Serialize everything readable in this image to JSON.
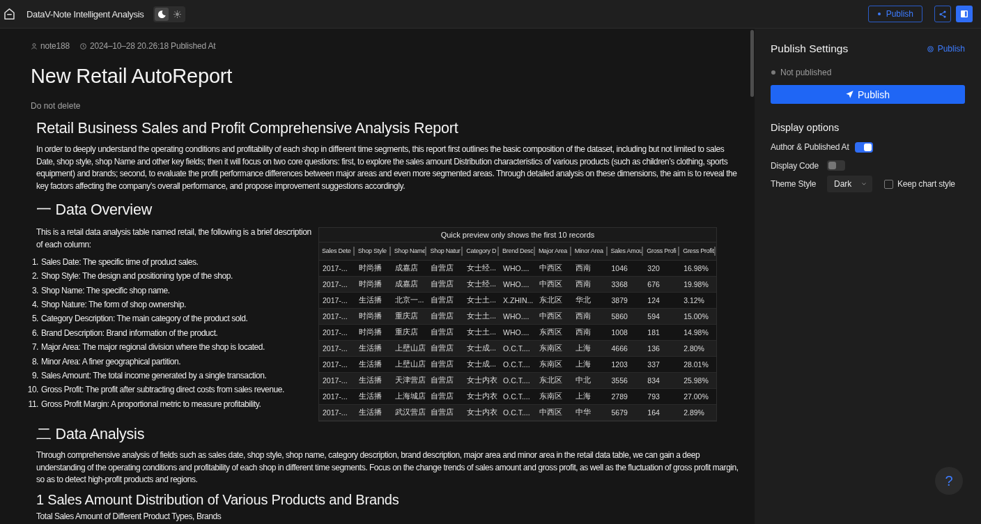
{
  "top_bar": {
    "title": "DataV-Note Intelligent Analysis",
    "theme_toggle": [
      {
        "kind": "dark",
        "selected": true
      },
      {
        "kind": "light",
        "selected": false
      }
    ],
    "publish_button": "Publish"
  },
  "report": {
    "author": "note188",
    "published_at": "2024–10–28 20.26:18 Published At",
    "title": "New Retail AutoReport",
    "note": "Do not delete",
    "blocks": [
      {
        "kind": "heading",
        "text": "Retail Business Sales and Profit Comprehensive Analysis Report"
      },
      {
        "kind": "paragraph",
        "text": "In order to deeply understand the operating conditions and profitability of each shop in different time segments, this report first outlines the basic composition of the dataset, including but not limited to sales Date, shop style, shop Name and other key fields; then it will focus on two core questions: first, to explore the sales amount Distribution characteristics of various products (such as children’s clothing, sports equipment) and brands; second, to evaluate the profit performance differences between major areas and even more segmented areas. Through detailed analysis on these dimensions, the aim is to reveal the key factors affecting the company’s overall performance, and propose improvement suggestions accordingly."
      },
      {
        "kind": "heading",
        "text": "一 Data Overview"
      },
      {
        "kind": "overview",
        "description": "This is a retail data analysis table named retail, the following is a brief description of each column:",
        "columns_description": [
          {
            "number": "1.",
            "text": "Sales Date: The specific time of product sales."
          },
          {
            "number": "2.",
            "text": "Shop Style: The design and positioning type of the shop."
          },
          {
            "number": "3.",
            "text": "Shop Name: The specific shop name."
          },
          {
            "number": "4.",
            "text": "Shop Nature: The form of shop ownership."
          },
          {
            "number": "5.",
            "text": "Category Description: The main category of the product sold."
          },
          {
            "number": "6.",
            "text": "Brand Description: Brand information of the product."
          },
          {
            "number": "7.",
            "text": "Major Area: The major regional division where the shop is located."
          },
          {
            "number": "8.",
            "text": "Minor Area: A finer geographical partition."
          },
          {
            "number": "9.",
            "text": "Sales Amount: The total income generated by a single transaction."
          },
          {
            "number": "10.",
            "text": "Gross Profit: The profit after subtracting direct costs from sales revenue."
          },
          {
            "number": "11.",
            "text": "Gross Profit Margin: A proportional metric to measure profitability."
          }
        ],
        "table": {
          "caption": "Quick preview only shows the first 10 records",
          "columns": [
            "Sales Dete",
            "Shop Style",
            "Shop Name",
            "Shop Natur",
            "Category D",
            "Brend Desc",
            "Major Area",
            "Minor Area",
            "Sales Amou",
            "Gross Profi",
            "Gress Profit"
          ],
          "rows": [
            [
              "2017-...",
              "时尚播",
              "成嘉店",
              "自营店",
              "女士经...",
              "WHO....",
              "中西区",
              "西南",
              "1046",
              "320",
              "16.98%"
            ],
            [
              "2017-...",
              "时尚播",
              "成嘉店",
              "自营店",
              "女士经...",
              "WHO....",
              "中西区",
              "西南",
              "3368",
              "676",
              "19.98%"
            ],
            [
              "2017-...",
              "生活播",
              "北京一...",
              "自营店",
              "女士土...",
              "X.ZHIN...",
              "东北区",
              "华北",
              "3879",
              "124",
              "3.12%"
            ],
            [
              "2017-...",
              "时尚播",
              "重庆店",
              "自营店",
              "女士土...",
              "WHO....",
              "中西区",
              "西南",
              "5860",
              "594",
              "15.00%"
            ],
            [
              "2017-...",
              "时尚播",
              "重庆店",
              "自营店",
              "女士土...",
              "WHO....",
              "东西区",
              "西南",
              "1008",
              "181",
              "14.98%"
            ],
            [
              "2017-...",
              "生活播",
              "上壁山店",
              "自营店",
              "女士成...",
              "O.C.T....",
              "东南区",
              "上海",
              "4666",
              "136",
              "2.80%"
            ],
            [
              "2017-...",
              "生活播",
              "上壁山店",
              "自营店",
              "女士成...",
              "O.C.T....",
              "东南区",
              "上海",
              "1203",
              "337",
              "28.01%"
            ],
            [
              "2017-...",
              "生活播",
              "天津营店",
              "自营店",
              "女士内衣",
              "O.C.T....",
              "东北区",
              "中北",
              "3556",
              "834",
              "25.98%"
            ],
            [
              "2017-...",
              "生活播",
              "上海城店",
              "自营店",
              "女士内衣",
              "O.C.T....",
              "东南区",
              "上海",
              "2789",
              "793",
              "27.00%"
            ],
            [
              "2017-...",
              "生活播",
              "武汉营店",
              "自营店",
              "女士内衣",
              "O.C.T....",
              "中西区",
              "中华",
              "5679",
              "164",
              "2.89%"
            ]
          ]
        }
      },
      {
        "kind": "heading",
        "text": "二 Data Analysis"
      },
      {
        "kind": "paragraph",
        "text": "Through comprehensive analysis of fields such as sales date, shop style, shop name, category description, brand description, major area and minor area in the retail data table, we can gain a deep understanding of the operating conditions and profitability of each shop in different time segments. Focus on the change trends of sales amount and gross profit, as well as the fluctuation of gross profit margin, so as to detect high-profit products and regions."
      },
      {
        "kind": "subheading",
        "text": "1 Sales Amount Distribution of Various Products and Brands"
      },
      {
        "kind": "paragraph",
        "text": "Total Sales Amount of Different Product Types, Brands"
      }
    ]
  },
  "publish_panel": {
    "title": "Publish Settings",
    "link": "Publish",
    "status": "Not published",
    "button": "Publish",
    "display_options": {
      "title": "Display options",
      "rows": [
        {
          "kind": "toggle",
          "label": "Author & Published At",
          "on": true
        },
        {
          "kind": "toggle",
          "label": "Display Code",
          "on": false
        },
        {
          "kind": "select",
          "label": "Theme Style",
          "value": "Dark",
          "checkbox": {
            "label": "Keep chart style",
            "checked": false
          }
        }
      ]
    }
  },
  "help_button": "?"
}
